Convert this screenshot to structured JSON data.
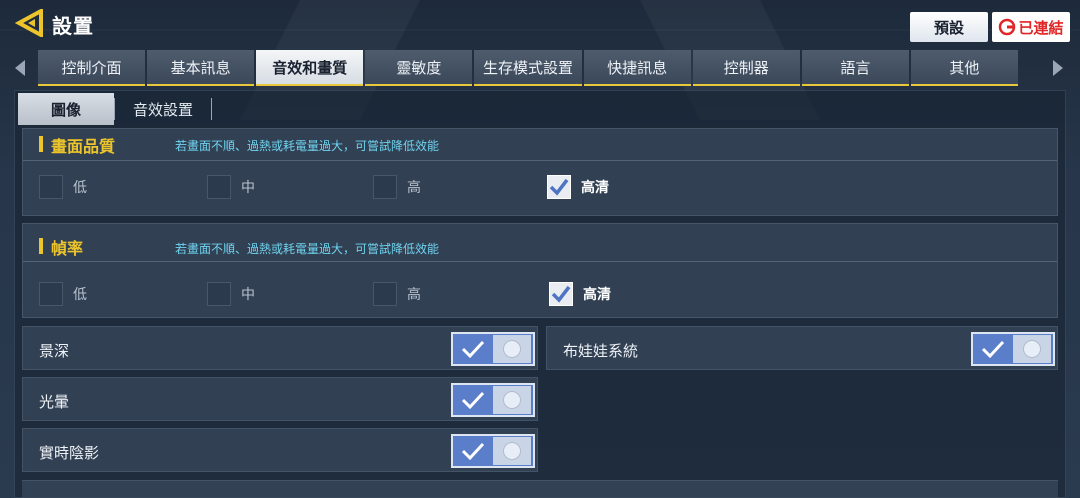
{
  "header": {
    "title": "設置",
    "preset_label": "預設",
    "connected_label": "已連結"
  },
  "tabs": [
    {
      "label": "控制介面",
      "active": false
    },
    {
      "label": "基本訊息",
      "active": false
    },
    {
      "label": "音效和畫質",
      "active": true
    },
    {
      "label": "靈敏度",
      "active": false
    },
    {
      "label": "生存模式設置",
      "active": false
    },
    {
      "label": "快捷訊息",
      "active": false
    },
    {
      "label": "控制器",
      "active": false
    },
    {
      "label": "語言",
      "active": false
    },
    {
      "label": "其他",
      "active": false
    }
  ],
  "subtabs": [
    {
      "label": "圖像",
      "active": true
    },
    {
      "label": "音效設置",
      "active": false
    }
  ],
  "quality": {
    "title": "畫面品質",
    "hint": "若畫面不順、過熱或耗電量過大，可嘗試降低效能",
    "options": [
      {
        "label": "低",
        "checked": false
      },
      {
        "label": "中",
        "checked": false
      },
      {
        "label": "高",
        "checked": false
      },
      {
        "label": "高清",
        "checked": true
      }
    ]
  },
  "framerate": {
    "title": "幀率",
    "hint": "若畫面不順、過熱或耗電量過大，可嘗試降低效能",
    "options": [
      {
        "label": "低",
        "checked": false
      },
      {
        "label": "中",
        "checked": false
      },
      {
        "label": "高",
        "checked": false
      },
      {
        "label": "高清",
        "checked": true
      }
    ]
  },
  "toggles": [
    {
      "label": "景深",
      "on": true
    },
    {
      "label": "布娃娃系統",
      "on": true
    },
    {
      "label": "光暈",
      "on": true
    },
    {
      "label": "實時陰影",
      "on": true
    }
  ],
  "colors": {
    "accent_yellow": "#ecc52c",
    "hint_cyan": "#6fd3ef",
    "toggle_blue": "#5a7ec9",
    "connected_red": "#e02626"
  }
}
